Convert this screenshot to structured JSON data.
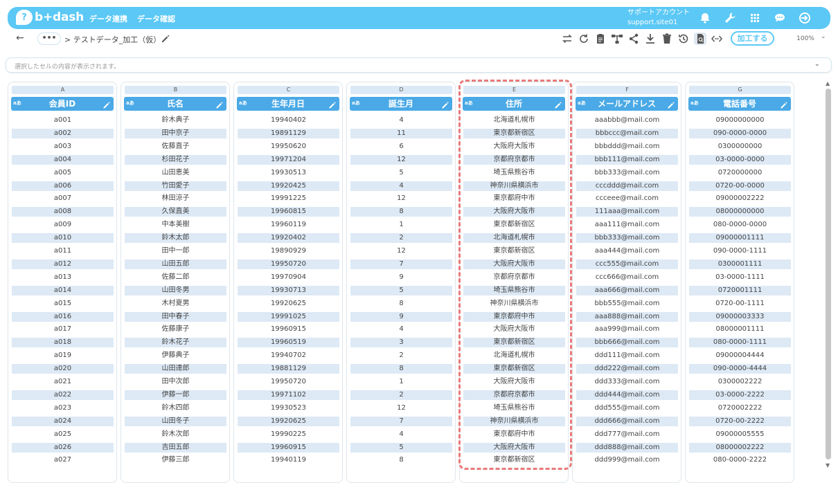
{
  "header": {
    "logo_mark": "?",
    "logo_text": "b+dash",
    "nav": [
      "データ連携",
      "データ確認"
    ],
    "account_line1": "サポートアカウント",
    "account_line2": "support.site01",
    "icons": [
      "bell-icon",
      "wrench-icon",
      "grid-icon",
      "chat-icon",
      "logout-icon"
    ],
    "accent_color": "#5bc8f5"
  },
  "toolbar": {
    "back": "←",
    "dots": "•••",
    "breadcrumb": "> テストデータ_加工（仮）",
    "process_button": "加工する",
    "zoom": "100%",
    "icons": [
      "swap-icon",
      "refresh-icon",
      "clipboard-icon",
      "hierarchy-icon",
      "share-icon",
      "download-icon",
      "trash-icon",
      "history-icon",
      "document-search-icon",
      "code-icon"
    ]
  },
  "cellbar": {
    "placeholder": "選択したセルの内容が表示されます。"
  },
  "table": {
    "type_label": "aあ",
    "columns": [
      {
        "letter": "A",
        "name": "会員ID"
      },
      {
        "letter": "B",
        "name": "氏名"
      },
      {
        "letter": "C",
        "name": "生年月日"
      },
      {
        "letter": "D",
        "name": "誕生月"
      },
      {
        "letter": "E",
        "name": "住所"
      },
      {
        "letter": "F",
        "name": "メールアドレス"
      },
      {
        "letter": "G",
        "name": "電話番号"
      }
    ],
    "rows": [
      [
        "a001",
        "鈴木典子",
        "19940402",
        "4",
        "北海道札幌市",
        "aaabbb@mail.com",
        "09000000000"
      ],
      [
        "a002",
        "田中京子",
        "19891129",
        "11",
        "東京都新宿区",
        "bbbccc@mail.com",
        "090-0000-0000"
      ],
      [
        "a003",
        "佐藤直子",
        "19950620",
        "6",
        "大阪府大阪市",
        "bbbddd@mail.com",
        "0300000000"
      ],
      [
        "a004",
        "杉田花子",
        "19971204",
        "12",
        "京都府京都市",
        "bbb111@mail.com",
        "03-0000-0000"
      ],
      [
        "a005",
        "山田恵美",
        "19930513",
        "5",
        "埼玉県熊谷市",
        "bbb333@mail.com",
        "0720000000"
      ],
      [
        "a006",
        "竹田愛子",
        "19920425",
        "4",
        "神奈川県横浜市",
        "cccddd@mail.com",
        "0720-00-0000"
      ],
      [
        "a007",
        "林田涼子",
        "19991225",
        "12",
        "東京都府中市",
        "ccceee@mail.com",
        "09000002222"
      ],
      [
        "a008",
        "久保直美",
        "19960815",
        "8",
        "大阪府大阪市",
        "111aaa@mail.com",
        "08000000000"
      ],
      [
        "a009",
        "中本美樹",
        "19960119",
        "1",
        "東京都新宿区",
        "aaa111@mail.com",
        "080-0000-0000"
      ],
      [
        "a010",
        "鈴木太郎",
        "19920402",
        "2",
        "北海道札幌市",
        "bbb333@mail.com",
        "09000001111"
      ],
      [
        "a011",
        "田中一郎",
        "19890929",
        "12",
        "東京都新宿区",
        "aaa444@mail.com",
        "090-0000-1111"
      ],
      [
        "a012",
        "山田五郎",
        "19950720",
        "7",
        "大阪府大阪市",
        "ccc555@mail.com",
        "0300001111"
      ],
      [
        "a013",
        "佐藤二郎",
        "19970904",
        "9",
        "京都府京都市",
        "ccc666@mail.com",
        "03-0000-1111"
      ],
      [
        "a014",
        "山田冬男",
        "19930713",
        "5",
        "埼玉県熊谷市",
        "aaa666@mail.com",
        "0720001111"
      ],
      [
        "a015",
        "木村夏男",
        "19920625",
        "8",
        "神奈川県横浜市",
        "bbb555@mail.com",
        "0720-00-1111"
      ],
      [
        "a016",
        "田中春子",
        "19991025",
        "9",
        "東京都府中市",
        "aaa888@mail.com",
        "09000003333"
      ],
      [
        "a017",
        "佐藤康子",
        "19960915",
        "4",
        "大阪府大阪市",
        "aaa999@mail.com",
        "08000001111"
      ],
      [
        "a018",
        "鈴木花子",
        "19960519",
        "3",
        "東京都新宿区",
        "bbb666@mail.com",
        "080-0000-1111"
      ],
      [
        "a019",
        "伊藤典子",
        "19940702",
        "2",
        "北海道札幌市",
        "ddd111@mail.com",
        "09000004444"
      ],
      [
        "a020",
        "山田達郎",
        "19881129",
        "8",
        "東京都新宿区",
        "ddd222@mail.com",
        "090-0000-4444"
      ],
      [
        "a021",
        "田中次郎",
        "19950720",
        "1",
        "大阪府大阪市",
        "ddd333@mail.com",
        "0300002222"
      ],
      [
        "a022",
        "伊藤一郎",
        "19971102",
        "2",
        "京都府京都市",
        "ddd444@mail.com",
        "03-0000-2222"
      ],
      [
        "a023",
        "鈴木四郎",
        "19930523",
        "12",
        "埼玉県熊谷市",
        "ddd555@mail.com",
        "0720002222"
      ],
      [
        "a024",
        "山田冬子",
        "19920625",
        "7",
        "神奈川県横浜市",
        "ddd666@mail.com",
        "0720-00-2222"
      ],
      [
        "a025",
        "鈴木次郎",
        "19990225",
        "4",
        "東京都府中市",
        "ddd777@mail.com",
        "09000005555"
      ],
      [
        "a026",
        "吉田五郎",
        "19960915",
        "5",
        "大阪府大阪市",
        "ddd888@mail.com",
        "08000002222"
      ],
      [
        "a027",
        "伊藤三郎",
        "19940119",
        "8",
        "東京都新宿区",
        "ddd999@mail.com",
        "080-0000-2222"
      ]
    ]
  }
}
